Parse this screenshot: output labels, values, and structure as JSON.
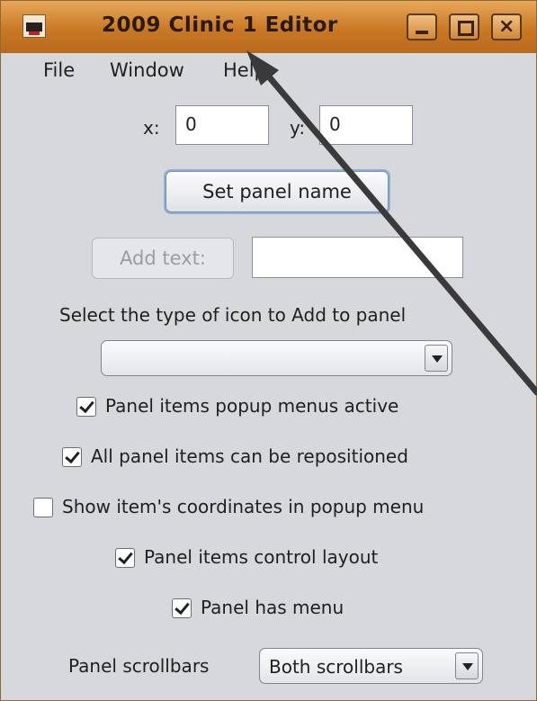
{
  "window": {
    "title": "2009 Clinic 1 Editor",
    "controls": {
      "minimize": "_",
      "maximize": "□",
      "close": "×"
    }
  },
  "menu": {
    "file": "File",
    "window": "Window",
    "help": "Help"
  },
  "coords": {
    "x_label": "x:",
    "x_value": "0",
    "y_label": "y:",
    "y_value": "0"
  },
  "buttons": {
    "set_panel_name": "Set panel name",
    "add_text": "Add text:"
  },
  "add_text_field": "",
  "icon_type": {
    "label": "Select the type of icon to Add to panel",
    "selected": ""
  },
  "options": [
    {
      "label": "Panel items popup menus active",
      "checked": true
    },
    {
      "label": "All panel items can be repositioned",
      "checked": true
    },
    {
      "label": "Show item's coordinates in popup menu",
      "checked": false
    },
    {
      "label": "Panel items control layout",
      "checked": true
    },
    {
      "label": "Panel has menu",
      "checked": true
    }
  ],
  "scrollbars": {
    "label": "Panel scrollbars",
    "selected": "Both scrollbars"
  },
  "colors": {
    "titlebar": "#c97824",
    "window_bg": "#d6d8dc",
    "pointer_arrow": "#3a3a3a"
  }
}
